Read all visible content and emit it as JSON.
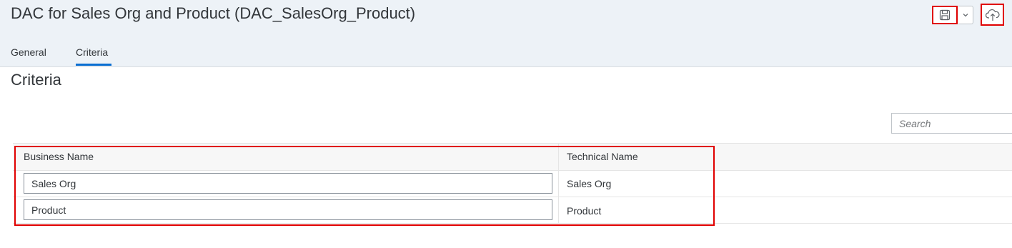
{
  "header": {
    "title": "DAC for Sales Org and Product (DAC_SalesOrg_Product)",
    "tabs": [
      {
        "label": "General",
        "active": false
      },
      {
        "label": "Criteria",
        "active": true
      }
    ],
    "toolbar": {
      "save_icon": "save-icon",
      "dropdown_icon": "chevron-down-icon",
      "deploy_icon": "cloud-upload-icon"
    }
  },
  "criteria": {
    "section_title": "Criteria",
    "search": {
      "placeholder": "Search",
      "value": ""
    },
    "table": {
      "columns": [
        "Business Name",
        "Technical Name"
      ],
      "rows": [
        {
          "business_name": "Sales Org",
          "technical_name": "Sales Org"
        },
        {
          "business_name": "Product",
          "technical_name": "Product"
        }
      ]
    }
  },
  "colors": {
    "accent": "#0a6ed1",
    "highlight": "#e00000",
    "header_bg": "#edf2f7"
  }
}
